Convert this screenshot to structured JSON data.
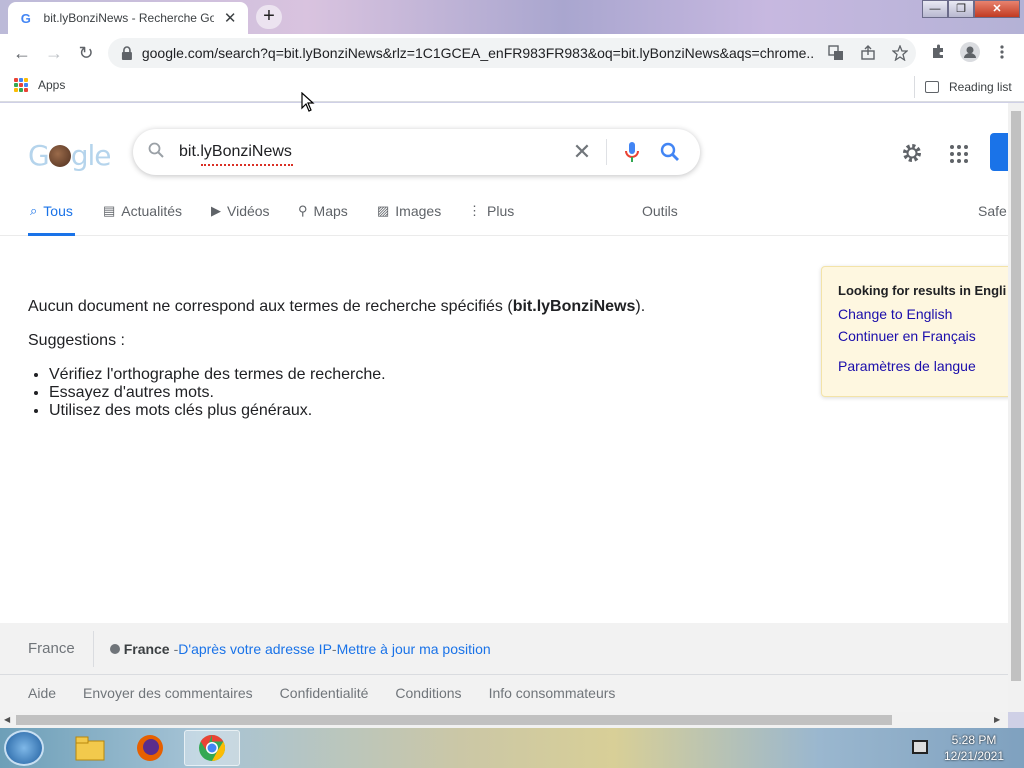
{
  "browser": {
    "tab": {
      "title": "bit.lyBonziNews - Recherche Google",
      "favicon": "G",
      "close": "✕"
    },
    "new_tab": "+",
    "window_controls": {
      "minimize": "—",
      "restore": "❐",
      "close": "✕"
    },
    "url": "google.com/search?q=bit.lyBonziNews&rlz=1C1GCEA_enFR983FR983&oq=bit.lyBonziNews&aqs=chrome.....",
    "nav": {
      "back": "←",
      "forward": "→",
      "reload": "↻"
    },
    "bookmarks": {
      "apps": "Apps",
      "reading_list": "Reading list"
    }
  },
  "search": {
    "query": "bit.lyBonziNews",
    "clear": "✕",
    "tabs": [
      {
        "label": "Tous",
        "icon": "⌕"
      },
      {
        "label": "Actualités",
        "icon": "▤"
      },
      {
        "label": "Vidéos",
        "icon": "▶"
      },
      {
        "label": "Maps",
        "icon": "⚲"
      },
      {
        "label": "Images",
        "icon": "▨"
      },
      {
        "label": "Plus",
        "icon": "⋮"
      },
      {
        "label": "Outils",
        "icon": ""
      },
      {
        "label": "Safe",
        "icon": ""
      }
    ]
  },
  "results": {
    "no_match_prefix": "Aucun document ne correspond aux termes de recherche spécifiés (",
    "no_match_term": "bit.lyBonziNews",
    "no_match_suffix": ").",
    "suggestions_title": "Suggestions :",
    "suggestions": [
      "Vérifiez l'orthographe des termes de recherche.",
      "Essayez d'autres mots.",
      "Utilisez des mots clés plus généraux."
    ]
  },
  "language_card": {
    "title": "Looking for results in Engli",
    "change": "Change to English",
    "continue": "Continuer en Français",
    "settings": "Paramètres de langue"
  },
  "footer": {
    "country": "France",
    "location_name": "France",
    "location_source": "D'après votre adresse IP",
    "separator": " - ",
    "update_location": "Mettre à jour ma position",
    "links": [
      "Aide",
      "Envoyer des commentaires",
      "Confidentialité",
      "Conditions",
      "Info consommateurs"
    ]
  },
  "taskbar": {
    "time": "5:28 PM",
    "date": "12/21/2021"
  },
  "colors": {
    "google_blue": "#1a73e8",
    "link_purple": "#1a0dab",
    "card_bg": "#fef7e0"
  }
}
